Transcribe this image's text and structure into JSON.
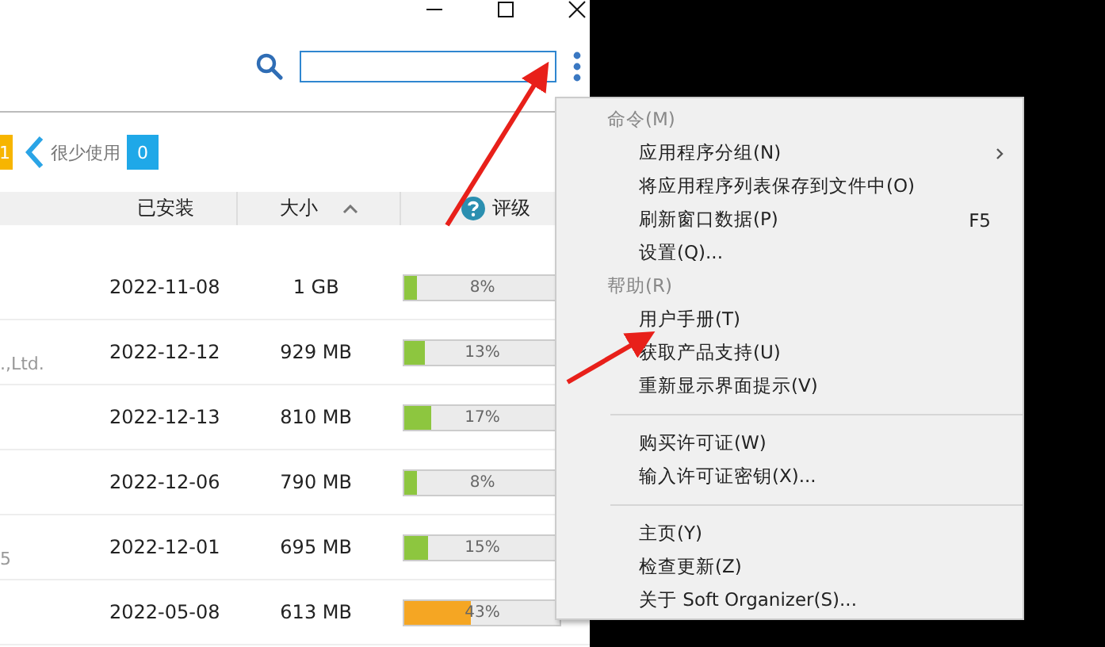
{
  "filters": {
    "prev_count": "1",
    "chip": "很少使用",
    "count": "0"
  },
  "table": {
    "columns": [
      {
        "label": "已安装",
        "kind": "plain"
      },
      {
        "label": "大小",
        "kind": "sorted"
      },
      {
        "label": "评级",
        "kind": "help"
      }
    ],
    "rows": [
      {
        "column_1": "",
        "installed": "2022-11-08",
        "size": "1 GB",
        "level": 0.08,
        "rating": "8%",
        "color": "#8dc63f"
      },
      {
        "column_1": ".,Ltd.",
        "installed": "2022-12-12",
        "size": "929 MB",
        "level": 0.13,
        "rating": "13%",
        "color": "#8dc63f"
      },
      {
        "column_1": "",
        "installed": "2022-12-13",
        "size": "810 MB",
        "level": 0.17,
        "rating": "17%",
        "color": "#8dc63f"
      },
      {
        "column_1": "",
        "installed": "2022-12-06",
        "size": "790 MB",
        "level": 0.08,
        "rating": "8%",
        "color": "#8dc63f"
      },
      {
        "column_1": "5",
        "installed": "2022-12-01",
        "size": "695 MB",
        "level": 0.15,
        "rating": "15%",
        "color": "#8dc63f"
      },
      {
        "column_1": "",
        "installed": "2022-05-08",
        "size": "613 MB",
        "level": 0.43,
        "rating": "43%",
        "color": "#f5a623"
      }
    ]
  },
  "menu": [
    {
      "kind": "header",
      "label": "命令(M)"
    },
    {
      "kind": "item",
      "label": "应用程序分组(N)",
      "submenu": true
    },
    {
      "kind": "item",
      "label": "将应用程序列表保存到文件中(O)"
    },
    {
      "kind": "item",
      "label": "刷新窗口数据(P)",
      "shortcut": "F5"
    },
    {
      "kind": "item",
      "label": "设置(Q)..."
    },
    {
      "kind": "header",
      "label": "帮助(R)"
    },
    {
      "kind": "item",
      "label": "用户手册(T)"
    },
    {
      "kind": "item",
      "label": "获取产品支持(U)"
    },
    {
      "kind": "item",
      "label": "重新显示界面提示(V)"
    },
    {
      "kind": "separator"
    },
    {
      "kind": "item",
      "label": "购买许可证(W)"
    },
    {
      "kind": "item",
      "label": "输入许可证密钥(X)..."
    },
    {
      "kind": "separator"
    },
    {
      "kind": "item",
      "label": "主页(Y)"
    },
    {
      "kind": "item",
      "label": "检查更新(Z)"
    },
    {
      "kind": "item",
      "label": "关于 Soft Organizer(S)..."
    }
  ],
  "annotations": [
    {
      "kind": "arrow"
    },
    {
      "kind": "arrow"
    }
  ]
}
